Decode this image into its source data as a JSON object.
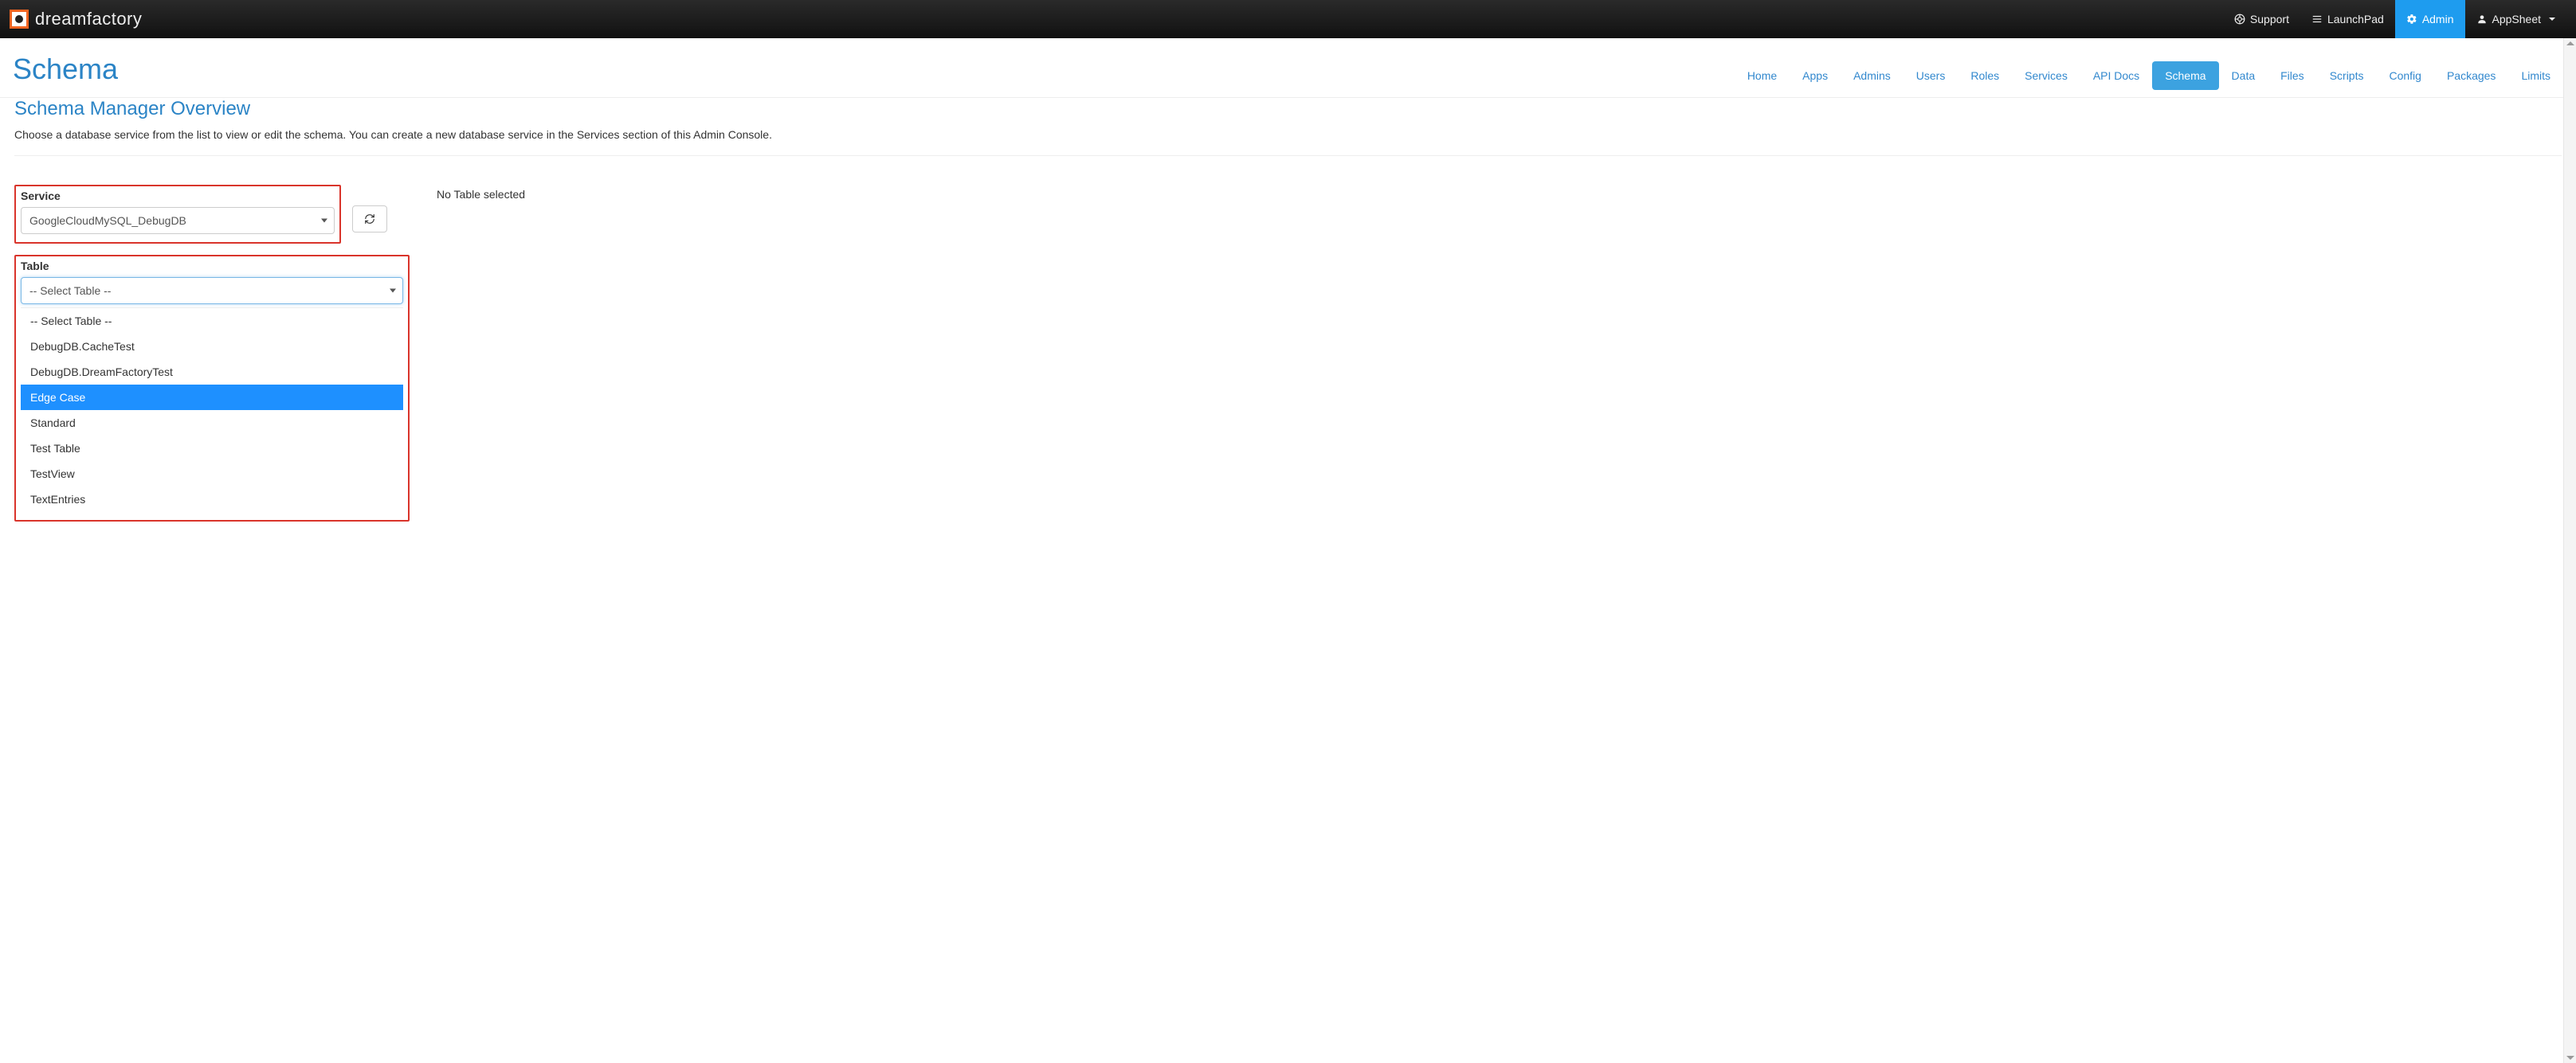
{
  "topbar": {
    "brand": "dreamfactory",
    "items": [
      {
        "label": "Support",
        "icon": "support"
      },
      {
        "label": "LaunchPad",
        "icon": "menu"
      },
      {
        "label": "Admin",
        "icon": "gear",
        "active": true
      },
      {
        "label": "AppSheet",
        "icon": "user",
        "caret": true
      }
    ]
  },
  "page": {
    "title": "Schema",
    "tabs": [
      "Home",
      "Apps",
      "Admins",
      "Users",
      "Roles",
      "Services",
      "API Docs",
      "Schema",
      "Data",
      "Files",
      "Scripts",
      "Config",
      "Packages",
      "Limits"
    ],
    "active_tab": "Schema"
  },
  "overview": {
    "heading": "Schema Manager Overview",
    "description": "Choose a database service from the list to view or edit the schema. You can create a new database service in the Services section of this Admin Console."
  },
  "service": {
    "label": "Service",
    "selected": "GoogleCloudMySQL_DebugDB"
  },
  "table": {
    "label": "Table",
    "selected": "-- Select Table --",
    "options": [
      "-- Select Table --",
      "DebugDB.CacheTest",
      "DebugDB.DreamFactoryTest",
      "Edge Case",
      "Standard",
      "Test Table",
      "TestView",
      "TextEntries"
    ],
    "highlighted": "Edge Case"
  },
  "right": {
    "no_table_msg": "No Table selected"
  }
}
